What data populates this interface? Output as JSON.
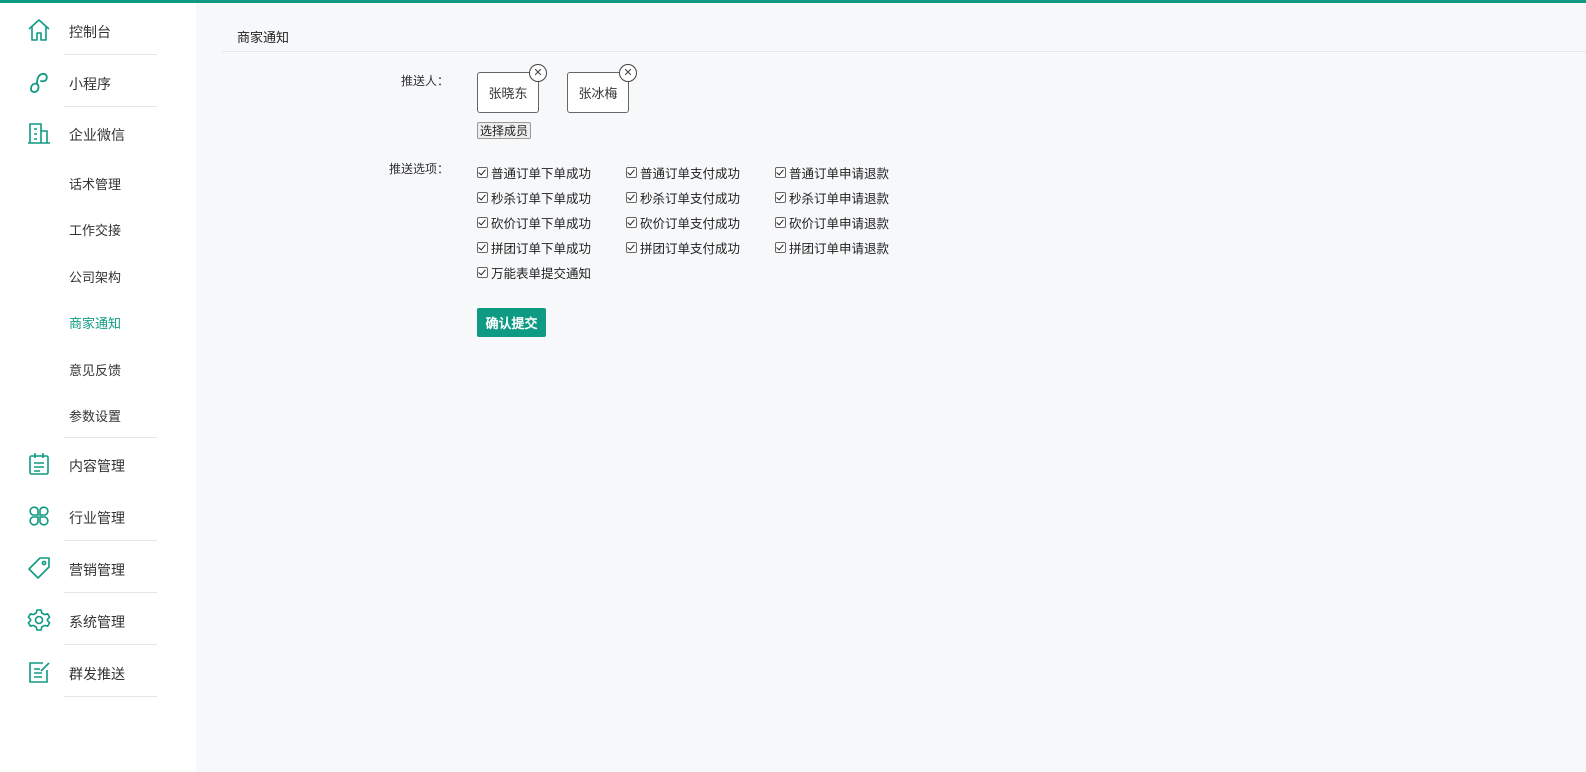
{
  "colors": {
    "accent": "#0f9a84",
    "background": "#f7f8fa",
    "sidebar": "#ffffff"
  },
  "sidebar": {
    "items": [
      {
        "label": "控制台",
        "icon": "home-icon"
      },
      {
        "label": "小程序",
        "icon": "miniprogram-icon"
      },
      {
        "label": "企业微信",
        "icon": "building-icon"
      },
      {
        "label": "内容管理",
        "icon": "calendar-list-icon"
      },
      {
        "label": "行业管理",
        "icon": "grid-icon"
      },
      {
        "label": "营销管理",
        "icon": "tag-icon"
      },
      {
        "label": "系统管理",
        "icon": "gear-icon"
      },
      {
        "label": "群发推送",
        "icon": "edit-list-icon"
      }
    ],
    "sub_items": [
      {
        "label": "话术管理",
        "active": false
      },
      {
        "label": "工作交接",
        "active": false
      },
      {
        "label": "公司架构",
        "active": false
      },
      {
        "label": "商家通知",
        "active": true
      },
      {
        "label": "意见反馈",
        "active": false
      },
      {
        "label": "参数设置",
        "active": false
      }
    ]
  },
  "main": {
    "title": "商家通知",
    "push_person_label": "推送人：",
    "members": [
      {
        "name": "张晓东",
        "remove": "✕"
      },
      {
        "name": "张冰梅",
        "remove": "✕"
      }
    ],
    "select_members_label": "选择成员",
    "push_options_label": "推送选项：",
    "options": [
      {
        "label": "普通订单下单成功",
        "checked": true
      },
      {
        "label": "普通订单支付成功",
        "checked": true
      },
      {
        "label": "普通订单申请退款",
        "checked": true
      },
      {
        "label": "秒杀订单下单成功",
        "checked": true
      },
      {
        "label": "秒杀订单支付成功",
        "checked": true
      },
      {
        "label": "秒杀订单申请退款",
        "checked": true
      },
      {
        "label": "砍价订单下单成功",
        "checked": true
      },
      {
        "label": "砍价订单支付成功",
        "checked": true
      },
      {
        "label": "砍价订单申请退款",
        "checked": true
      },
      {
        "label": "拼团订单下单成功",
        "checked": true
      },
      {
        "label": "拼团订单支付成功",
        "checked": true
      },
      {
        "label": "拼团订单申请退款",
        "checked": true
      },
      {
        "label": "万能表单提交通知",
        "checked": true
      }
    ],
    "submit_label": "确认提交"
  }
}
